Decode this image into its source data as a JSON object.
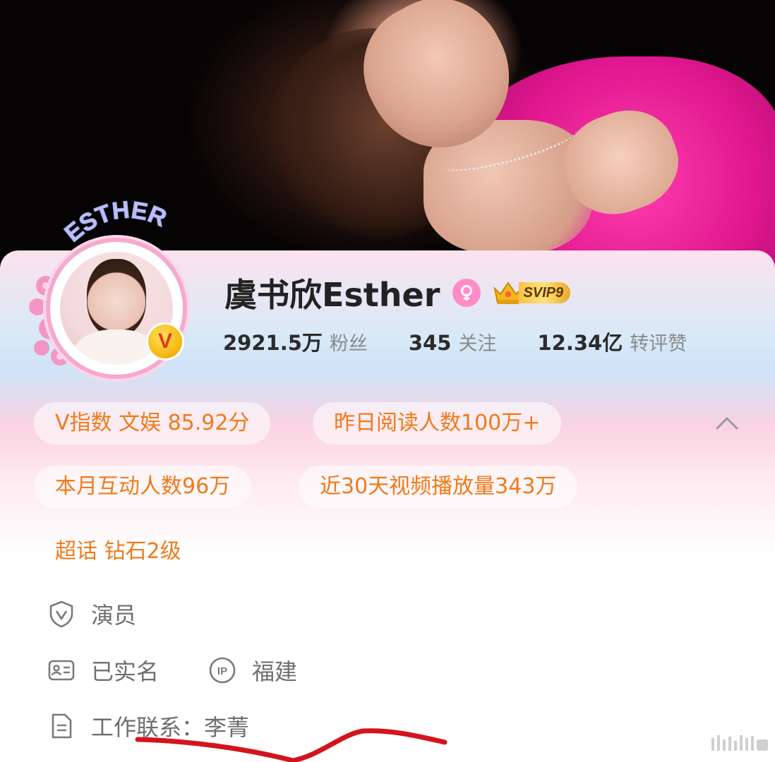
{
  "profile": {
    "name": "虞书欣Esther",
    "avatar_title": "ESTHER",
    "verified_badge": "V",
    "svip_badge": "SVIP9"
  },
  "stats": [
    {
      "value": "2921.5万",
      "label": "粉丝"
    },
    {
      "value": "345",
      "label": "关注"
    },
    {
      "value": "12.34亿",
      "label": "转评赞"
    }
  ],
  "tags": {
    "v_index": "V指数 文娱 85.92分",
    "yesterday_reads": "昨日阅读人数100万+",
    "monthly_interactions": "本月互动人数96万",
    "video_views_30d": "近30天视频播放量343万",
    "super_topic": "超话 钻石2级"
  },
  "info": {
    "occupation": "演员",
    "real_name": "已实名",
    "ip_location": "福建",
    "ip_label": "IP",
    "work_contact": "工作联系：李菁"
  },
  "icons": {
    "gender": "female-icon",
    "collapse": "chevron-up-icon",
    "occupation": "shield-v-icon",
    "real_name": "id-card-icon",
    "ip": "ip-circle-icon",
    "contact": "document-icon"
  },
  "colors": {
    "accent_orange": "#f07a1a",
    "gender_pink": "#ff8cc6",
    "svip_gold": "#f7c24b",
    "annotation_red": "#d4141c"
  }
}
